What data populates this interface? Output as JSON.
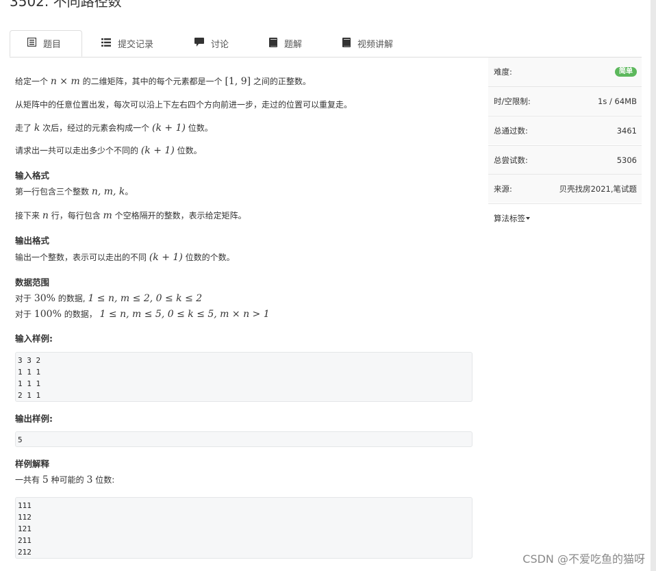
{
  "problem": {
    "title": "3502. 不同路径数"
  },
  "tabs": [
    {
      "label": "题目",
      "icon": "list-alt-icon",
      "active": true
    },
    {
      "label": "提交记录",
      "icon": "list-icon"
    },
    {
      "label": "讨论",
      "icon": "comment-icon"
    },
    {
      "label": "题解",
      "icon": "book-icon"
    },
    {
      "label": "视频讲解",
      "icon": "book-icon"
    }
  ],
  "statement": {
    "p1_a": "给定一个",
    "p1_b": "的二维矩阵，其中的每个元素都是一个",
    "p1_c": "之间的正整数。",
    "p1_m1": "n × m",
    "p1_m2": "[1, 9]",
    "p2": "从矩阵中的任意位置出发，每次可以沿上下左右四个方向前进一步，走过的位置可以重复走。",
    "p3_a": "走了",
    "p3_m1": "k",
    "p3_b": "次后，经过的元素会构成一个",
    "p3_m2": "(k + 1)",
    "p3_c": "位数。",
    "p4_a": "请求出一共可以走出多少个不同的",
    "p4_m": "(k + 1)",
    "p4_b": "位数。"
  },
  "input_format": {
    "heading": "输入格式",
    "l1_a": "第一行包含三个整数",
    "l1_m": "n, m, k",
    "l1_b": "。",
    "l2_a": "接下来",
    "l2_m1": "n",
    "l2_b": "行，每行包含",
    "l2_m2": "m",
    "l2_c": "个空格隔开的整数，表示给定矩阵。"
  },
  "output_format": {
    "heading": "输出格式",
    "l1_a": "输出一个整数，表示可以走出的不同",
    "l1_m": "(k + 1)",
    "l1_b": "位数的个数。"
  },
  "data_range": {
    "heading": "数据范围",
    "l1_a": "对于",
    "l1_m1": "30%",
    "l1_b": "的数据,",
    "l1_m2": "1 ≤ n, m ≤ 2, 0 ≤ k ≤ 2",
    "l2_a": "对于",
    "l2_m1": "100%",
    "l2_b": "的数据，",
    "l2_m2": "1 ≤ n, m ≤ 5, 0 ≤ k ≤ 5, m × n > 1"
  },
  "sample_input": {
    "heading": "输入样例:",
    "lines": [
      "3 3 2",
      "1 1 1",
      "1 1 1",
      "2 1 1"
    ]
  },
  "sample_output": {
    "heading": "输出样例:",
    "lines": [
      "5"
    ]
  },
  "explanation": {
    "heading": "样例解释",
    "l1_a": "一共有",
    "l1_m1": "5",
    "l1_b": "种可能的",
    "l1_m2": "3",
    "l1_c": "位数:",
    "lines": [
      "111",
      "112",
      "121",
      "211",
      "212"
    ]
  },
  "sidebar": {
    "difficulty_label": "难度:",
    "difficulty_value": "简单",
    "difficulty_color": "#5cb85c",
    "limit_label": "时/空限制:",
    "limit_value": "1s / 64MB",
    "passed_label": "总通过数:",
    "passed_value": "3461",
    "tried_label": "总尝试数:",
    "tried_value": "5306",
    "source_label": "来源:",
    "source_value": "贝壳找房2021,笔试题",
    "tags_label": "算法标签"
  },
  "watermark": "CSDN @不爱吃鱼的猫呀"
}
